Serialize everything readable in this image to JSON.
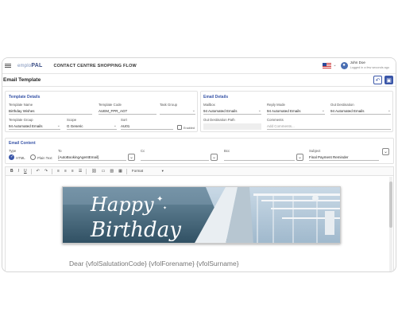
{
  "app": {
    "logo_prefix": "emplo",
    "logo_suffix": "PAL",
    "title": "CONTACT CENTRE SHOPPING FLOW",
    "user_name": "John Doe",
    "user_status": "Logged in a few seconds ago"
  },
  "page": {
    "title": "Email Template"
  },
  "template_details": {
    "section_title": "Template Details",
    "template_name_label": "Template Name",
    "template_name_value": "Birthday Wishes",
    "template_code_label": "Template Code",
    "template_code_value": "AUEM_FPR_AGT",
    "task_group_label": "Task Group",
    "task_group_value": "",
    "template_group_label": "Template Group",
    "template_group_value": "94 Automated Emails",
    "scope_label": "Scope",
    "scope_value": "G Generic",
    "sort_label": "Sort",
    "sort_value": "AU01",
    "enabled_label": "Enabled"
  },
  "email_details": {
    "section_title": "Email Details",
    "mailbox_label": "Mailbox",
    "mailbox_value": "94 Automated Emails",
    "reply_mode_label": "Reply Mode",
    "reply_mode_value": "94 Automated Emails",
    "out_destination_label": "Out Destination",
    "out_destination_value": "94 Automated Emails",
    "out_destination_path_label": "Out Destination Path",
    "comments_label": "Comments",
    "comments_placeholder": "Add Comments..."
  },
  "email_content": {
    "section_title": "Email Content",
    "type_label": "Type",
    "type_html": "HTML",
    "type_plain": "Plain Text",
    "to_label": "To",
    "to_value": "{AutoBookingAgentEmail}",
    "cc_label": "Cc",
    "bcc_label": "Bcc",
    "subject_label": "Subject",
    "subject_value": "Final Payment Reminder"
  },
  "editor": {
    "format_label": "Format",
    "banner_line1": "Happy",
    "banner_line2": "Birthday",
    "body_greeting": "Dear {vfolSalutationCode} {vfolForename} {vfolSurname}"
  },
  "colors": {
    "accent": "#3a56a8",
    "section_title": "#3a56a8"
  }
}
